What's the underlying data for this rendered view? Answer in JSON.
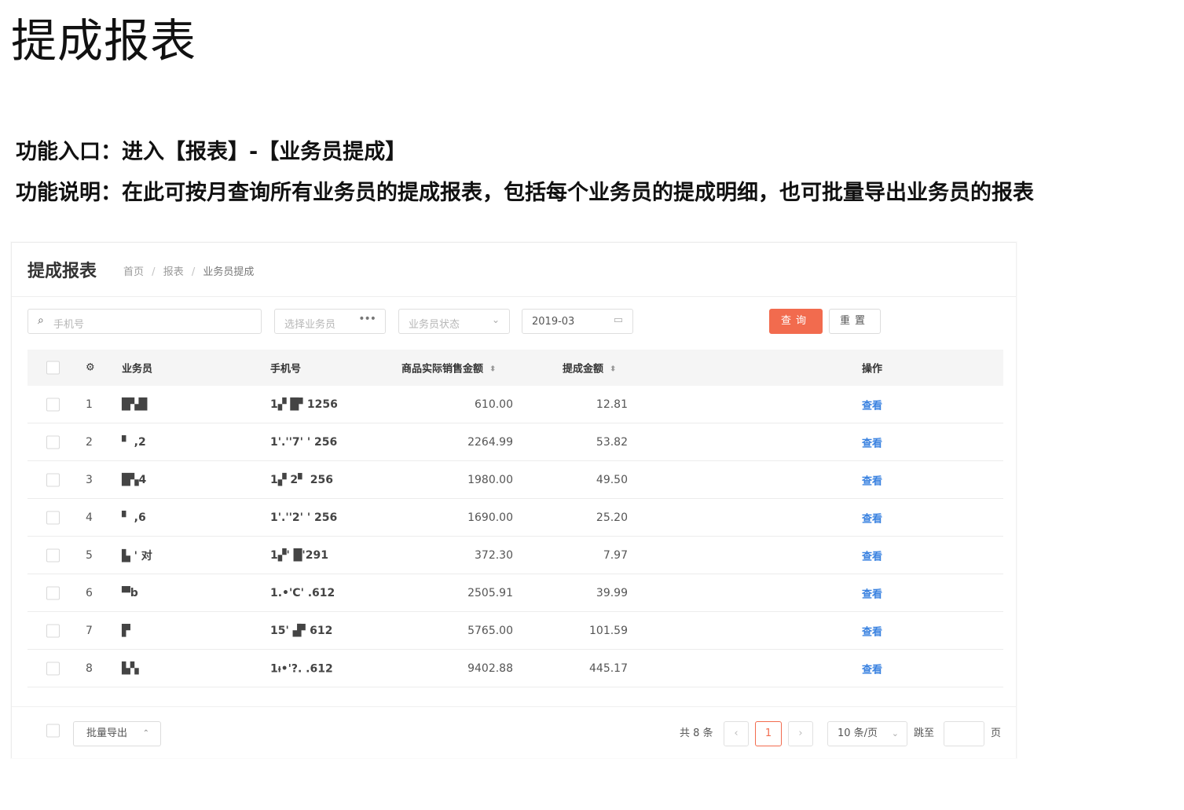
{
  "doc": {
    "title": "提成报表",
    "entry_line": "功能入口：进入【报表】-【业务员提成】",
    "desc_line": "功能说明：在此可按月查询所有业务员的提成报表，包括每个业务员的提成明细，也可批量导出业务员的报表"
  },
  "app": {
    "page_title": "提成报表",
    "breadcrumb": [
      "首页",
      "报表",
      "业务员提成"
    ],
    "breadcrumb_sep": "/",
    "filters": {
      "phone_placeholder": "手机号",
      "sales_placeholder": "选择业务员",
      "status_placeholder": "业务员状态",
      "date_value": "2019-03"
    },
    "buttons": {
      "query": "查询",
      "reset": "重置"
    },
    "table": {
      "headers": {
        "index": "⚙",
        "name": "业务员",
        "phone": "手机号",
        "amount": "商品实际销售金额",
        "commission": "提成金额",
        "op": "操作"
      },
      "rows": [
        {
          "idx": "1",
          "name": "█▚█",
          "phone": "1▞ █▘1256",
          "amount": "610.00",
          "commission": "12.81",
          "op": "查看"
        },
        {
          "idx": "2",
          "name": "▘ ,2",
          "phone": "1'.''7' ' 256",
          "amount": "2264.99",
          "commission": "53.82",
          "op": "查看"
        },
        {
          "idx": "3",
          "name": "█▚4",
          "phone": "1▞ 2▘ 256",
          "amount": "1980.00",
          "commission": "49.50",
          "op": "查看"
        },
        {
          "idx": "4",
          "name": "▘ ,6",
          "phone": "1'.''2' ' 256",
          "amount": "1690.00",
          "commission": "25.20",
          "op": "查看"
        },
        {
          "idx": "5",
          "name": "▙ ' 对",
          "phone": "1▞' █'291",
          "amount": "372.30",
          "commission": "7.97",
          "op": "查看"
        },
        {
          "idx": "6",
          "name": "▀b",
          "phone": "1.•'C' .612",
          "amount": "2505.91",
          "commission": "39.99",
          "op": "查看"
        },
        {
          "idx": "7",
          "name": "▛",
          "phone": "15' ▟▘612",
          "amount": "5765.00",
          "commission": "101.59",
          "op": "查看"
        },
        {
          "idx": "8",
          "name": "▙▚",
          "phone": "1ᵼ•'?. .612",
          "amount": "9402.88",
          "commission": "445.17",
          "op": "查看"
        }
      ]
    },
    "footer": {
      "export_label": "批量导出",
      "total": "共 8 条",
      "current_page": "1",
      "page_size": "10 条/页",
      "jump_label": "跳至",
      "page_label": "页"
    }
  }
}
